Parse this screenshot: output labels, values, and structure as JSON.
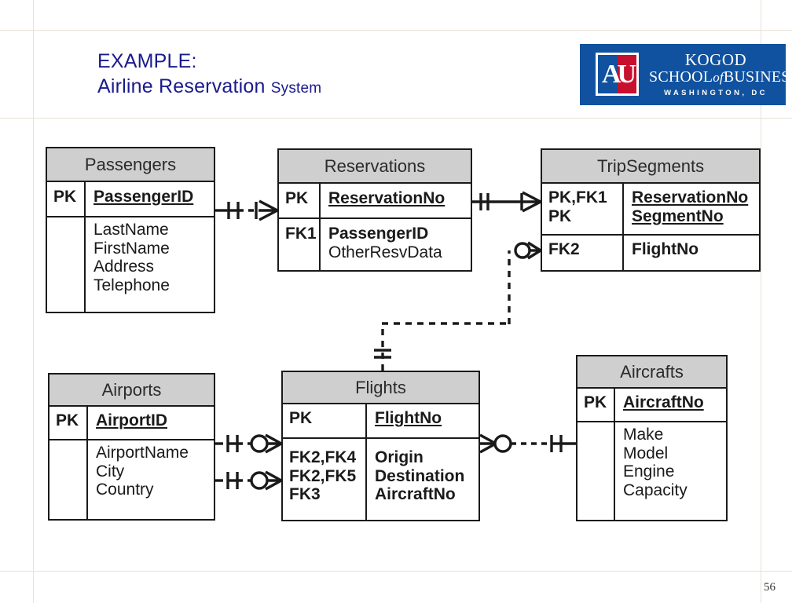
{
  "slide": {
    "title_line1": "EXAMPLE:",
    "title_line2_main": "Airline Reservation",
    "title_line2_small": "System",
    "title_color": "#1a1a8c",
    "page_number": "56",
    "background": "#ffffff"
  },
  "logo": {
    "monogram": "AU",
    "line1": "KOGOD",
    "line2_a": "SCHOOL",
    "line2_of": "of",
    "line2_b": "BUSINESS",
    "line3": "WASHINGTON, DC",
    "bg_color": "#10529f",
    "accent_color": "#c8102e"
  },
  "diagram": {
    "type": "entity-relationship-diagram",
    "notation": "crows-foot",
    "header_fill": "#cfcfcf",
    "line_color": "#1a1a1a",
    "entities": [
      {
        "id": "passengers",
        "name": "Passengers",
        "sections": [
          {
            "key": "PK",
            "fields": [
              {
                "text": "PassengerID",
                "style": "pk"
              }
            ]
          },
          {
            "key": "",
            "fields": [
              {
                "text": "LastName",
                "style": "plain"
              },
              {
                "text": "FirstName",
                "style": "plain"
              },
              {
                "text": "Address",
                "style": "plain"
              },
              {
                "text": "Telephone",
                "style": "plain"
              }
            ]
          }
        ]
      },
      {
        "id": "reservations",
        "name": "Reservations",
        "sections": [
          {
            "key": "PK",
            "fields": [
              {
                "text": "ReservationNo",
                "style": "pk"
              }
            ]
          },
          {
            "key": "FK1",
            "fields": [
              {
                "text": "PassengerID",
                "style": "fk"
              },
              {
                "text": "OtherResvData",
                "style": "plain"
              }
            ]
          }
        ]
      },
      {
        "id": "tripsegments",
        "name": "TripSegments",
        "sections": [
          {
            "key": "PK,FK1\nPK",
            "fields": [
              {
                "text": "ReservationNo",
                "style": "pk"
              },
              {
                "text": "SegmentNo",
                "style": "pk"
              }
            ]
          },
          {
            "key": "FK2",
            "fields": [
              {
                "text": "FlightNo",
                "style": "fk"
              }
            ]
          }
        ]
      },
      {
        "id": "airports",
        "name": "Airports",
        "sections": [
          {
            "key": "PK",
            "fields": [
              {
                "text": "AirportID",
                "style": "pk"
              }
            ]
          },
          {
            "key": "",
            "fields": [
              {
                "text": "AirportName",
                "style": "plain"
              },
              {
                "text": "City",
                "style": "plain"
              },
              {
                "text": "Country",
                "style": "plain"
              }
            ]
          }
        ]
      },
      {
        "id": "flights",
        "name": "Flights",
        "sections": [
          {
            "key": "PK",
            "fields": [
              {
                "text": "FlightNo",
                "style": "pk"
              }
            ]
          },
          {
            "key": "FK2,FK4\nFK2,FK5\nFK3",
            "fields": [
              {
                "text": "Origin",
                "style": "fk"
              },
              {
                "text": "Destination",
                "style": "fk"
              },
              {
                "text": "AircraftNo",
                "style": "fk"
              }
            ]
          }
        ]
      },
      {
        "id": "aircrafts",
        "name": "Aircrafts",
        "sections": [
          {
            "key": "PK",
            "fields": [
              {
                "text": "AircraftNo",
                "style": "pk"
              }
            ]
          },
          {
            "key": "",
            "fields": [
              {
                "text": "Make",
                "style": "plain"
              },
              {
                "text": "Model",
                "style": "plain"
              },
              {
                "text": "Engine",
                "style": "plain"
              },
              {
                "text": "Capacity",
                "style": "plain"
              }
            ]
          }
        ]
      }
    ],
    "relationships": [
      {
        "from": "Passengers",
        "to": "Reservations",
        "line": "dashed",
        "from_card": "one-mandatory",
        "to_card": "one-or-many"
      },
      {
        "from": "Reservations",
        "to": "TripSegments",
        "line": "solid",
        "from_card": "one-and-only-one",
        "to_card": "one-or-many"
      },
      {
        "from": "Flights",
        "to": "TripSegments",
        "line": "dashed",
        "from_card": "one-mandatory",
        "to_card": "zero-or-many"
      },
      {
        "from": "Airports",
        "to": "Flights",
        "line": "dashed",
        "from_card": "one-mandatory",
        "to_card": "zero-or-many"
      },
      {
        "from": "Airports",
        "to": "Flights",
        "line": "dashed",
        "from_card": "one-mandatory",
        "to_card": "zero-or-many"
      },
      {
        "from": "Aircrafts",
        "to": "Flights",
        "line": "dashed",
        "from_card": "one-mandatory",
        "to_card": "zero-or-many"
      }
    ]
  }
}
